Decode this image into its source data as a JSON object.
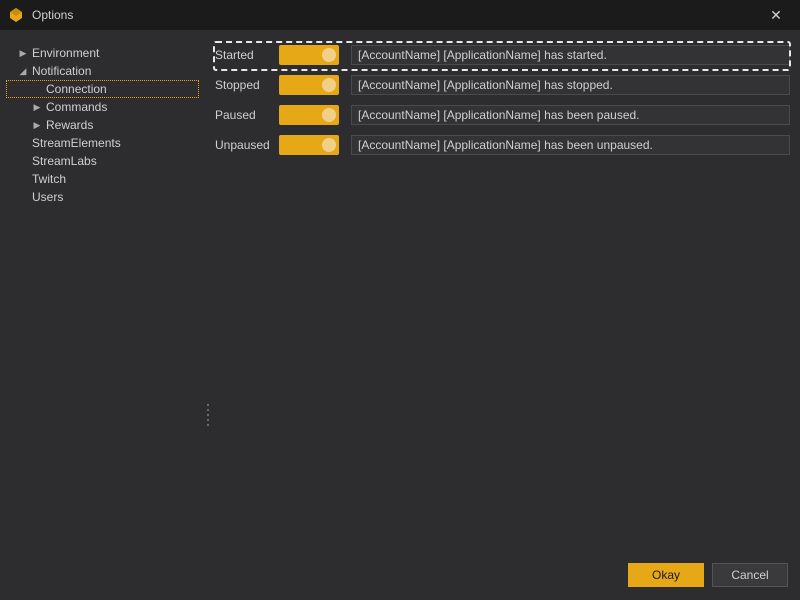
{
  "window": {
    "title": "Options",
    "close_glyph": "✕"
  },
  "sidebar": {
    "items": [
      {
        "label": "Environment",
        "level": 0,
        "expander": "▶",
        "selected": false
      },
      {
        "label": "Notification",
        "level": 0,
        "expander": "◢",
        "selected": false
      },
      {
        "label": "Connection",
        "level": 1,
        "expander": "",
        "selected": true
      },
      {
        "label": "Commands",
        "level": 1,
        "expander": "▶",
        "selected": false
      },
      {
        "label": "Rewards",
        "level": 1,
        "expander": "▶",
        "selected": false
      },
      {
        "label": "StreamElements",
        "level": 0,
        "expander": "",
        "selected": false
      },
      {
        "label": "StreamLabs",
        "level": 0,
        "expander": "",
        "selected": false
      },
      {
        "label": "Twitch",
        "level": 0,
        "expander": "",
        "selected": false
      },
      {
        "label": "Users",
        "level": 0,
        "expander": "",
        "selected": false
      }
    ]
  },
  "rows": [
    {
      "label": "Started",
      "enabled": true,
      "text": "[AccountName] [ApplicationName] has started."
    },
    {
      "label": "Stopped",
      "enabled": true,
      "text": "[AccountName] [ApplicationName] has stopped."
    },
    {
      "label": "Paused",
      "enabled": true,
      "text": "[AccountName] [ApplicationName] has been paused."
    },
    {
      "label": "Unpaused",
      "enabled": true,
      "text": "[AccountName] [ApplicationName] has been unpaused."
    }
  ],
  "footer": {
    "okay": "Okay",
    "cancel": "Cancel"
  }
}
